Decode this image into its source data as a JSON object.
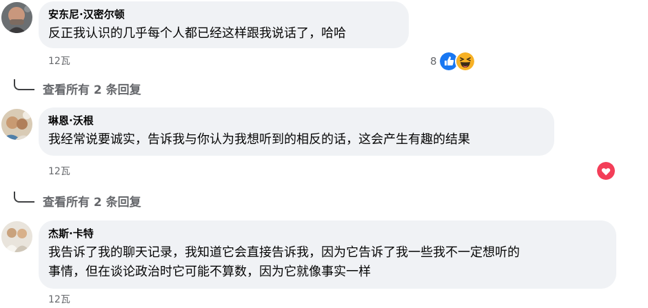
{
  "comments": [
    {
      "author": "安东尼·汉密尔顿",
      "lines": [
        "反正我认识的几乎每个人都已经这样跟我说话了，哈哈"
      ],
      "time": "12瓦",
      "reactions": {
        "count": "8",
        "icons": [
          "like-icon",
          "haha-icon"
        ]
      },
      "replies_label": "查看所有 2 条回复"
    },
    {
      "author": "琳恩·沃根",
      "lines": [
        "我经常说要诚实，告诉我与你认为我想听到的相反的话，这会产生有趣的结果"
      ],
      "time": "12瓦",
      "reactions": {
        "count": "",
        "icons": [
          "love-icon"
        ]
      },
      "replies_label": "查看所有 2 条回复"
    },
    {
      "author": "杰斯·卡特",
      "lines": [
        "我告诉了我的聊天记录，我知道它会直接告诉我，因为它告诉了我一些我不一定想听的",
        "事情，但在谈论政治时它可能不算数，因为它就像事实一样"
      ],
      "time": "12瓦"
    }
  ],
  "colors": {
    "bubble": "#f0f2f5",
    "meta_text": "#65676b",
    "like_blue": "#1877f2",
    "love_red": "#f33e58",
    "haha_yellow": "#f7b125"
  }
}
